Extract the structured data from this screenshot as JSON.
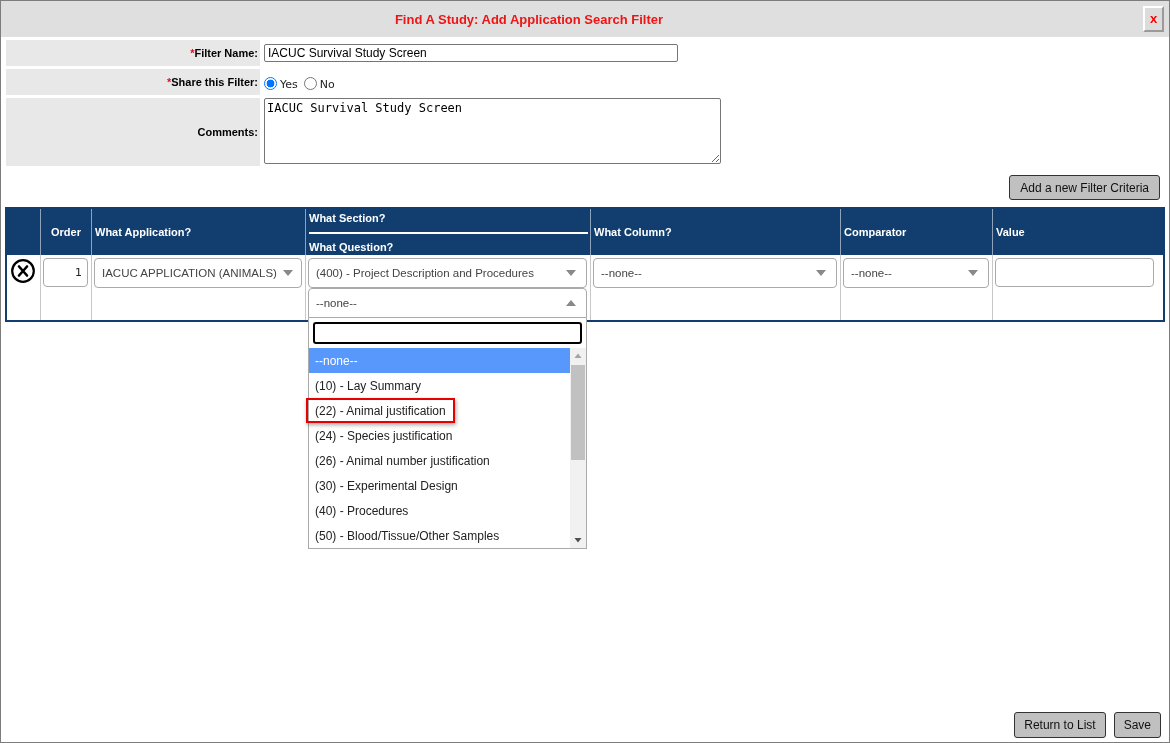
{
  "window": {
    "title": "Find A Study: Add Application Search Filter",
    "close_button": "x"
  },
  "form": {
    "fields": [
      {
        "kind": "text",
        "required_mark": "*",
        "label": "Filter Name:",
        "value": "IACUC Survival Study Screen"
      },
      {
        "kind": "radio",
        "required_mark": "*",
        "label": "Share this Filter:",
        "options": [
          {
            "label": "Yes",
            "selected": true
          },
          {
            "label": "No",
            "selected": false
          }
        ]
      },
      {
        "kind": "textarea",
        "label": "Comments:",
        "value": "IACUC Survival Study Screen"
      }
    ]
  },
  "add_criteria_button": "Add a new Filter Criteria",
  "criteria_table": {
    "columns": [
      {
        "label": "Order"
      },
      {
        "label": "What Application?"
      },
      {
        "label": "What Section?",
        "sublabel": "What Question?"
      },
      {
        "label": "What Column?"
      },
      {
        "label": "Comparator"
      },
      {
        "label": "Value"
      }
    ],
    "rows": [
      {
        "order": "1",
        "application": "IACUC APPLICATION (ANIMALS)",
        "section": "(400) - Project Description and Procedures",
        "question": {
          "value": "--none--",
          "expanded": true,
          "options": [
            {
              "label": "--none--",
              "selected": true,
              "marked": false
            },
            {
              "label": "(10) - Lay Summary",
              "selected": false,
              "marked": false
            },
            {
              "label": "(22) - Animal justification",
              "selected": false,
              "marked": true
            },
            {
              "label": "(24) - Species justification",
              "selected": false,
              "marked": false
            },
            {
              "label": "(26) - Animal number justification",
              "selected": false,
              "marked": false
            },
            {
              "label": "(30) - Experimental Design",
              "selected": false,
              "marked": false
            },
            {
              "label": "(40) - Procedures",
              "selected": false,
              "marked": false
            },
            {
              "label": "(50) - Blood/Tissue/Other Samples",
              "selected": false,
              "marked": false
            }
          ]
        },
        "column": "--none--",
        "comparator": "--none--"
      }
    ]
  },
  "footer_buttons": [
    "Return to List",
    "Save"
  ]
}
